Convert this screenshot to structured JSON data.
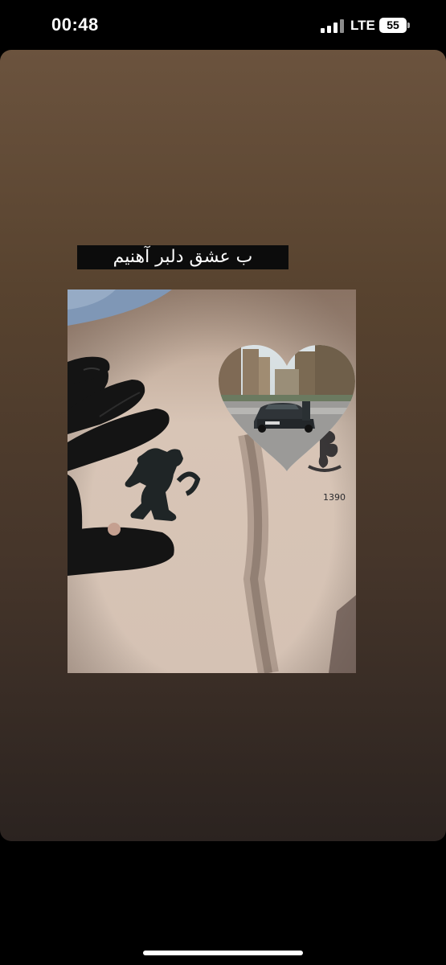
{
  "status_bar": {
    "time": "00:48",
    "network": "LTE",
    "battery": "55"
  },
  "story": {
    "caption": "ب عشق دلبر آهنیم",
    "photo_icon": "peugeot-lion-tattoo-photo",
    "heart_icon": "heart-car-photo"
  }
}
